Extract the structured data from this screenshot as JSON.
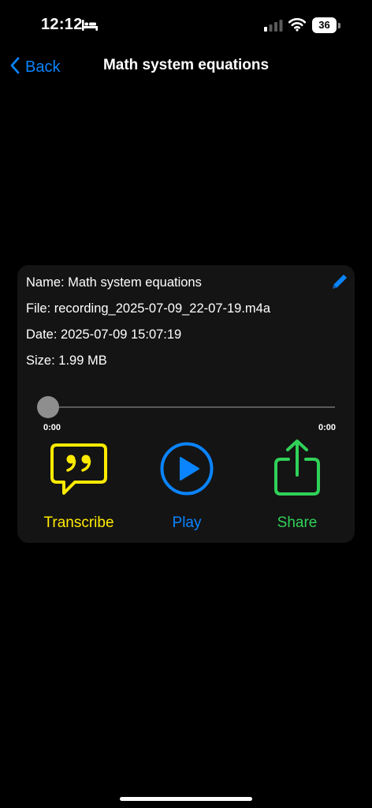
{
  "status_bar": {
    "time": "12:12",
    "battery": "36"
  },
  "nav": {
    "back_label": "Back",
    "title": "Math system equations"
  },
  "recording": {
    "name_line": "Name: Math system equations",
    "file_line": "File: recording_2025-07-09_22-07-19.m4a",
    "date_line": "Date: 2025-07-09 15:07:19",
    "size_line": "Size: 1.99 MB"
  },
  "player": {
    "current_time": "0:00",
    "total_time": "0:00",
    "progress": 0
  },
  "actions": {
    "transcribe_label": "Transcribe",
    "play_label": "Play",
    "share_label": "Share"
  },
  "colors": {
    "accent_blue": "#0a84ff",
    "transcribe_yellow": "#ffea00",
    "share_green": "#30d158"
  },
  "icons": [
    "bed-icon",
    "cellular-signal-icon",
    "wifi-icon",
    "battery-icon",
    "chevron-left-icon",
    "pencil-icon",
    "quote-bubble-icon",
    "play-circle-icon",
    "share-icon"
  ]
}
